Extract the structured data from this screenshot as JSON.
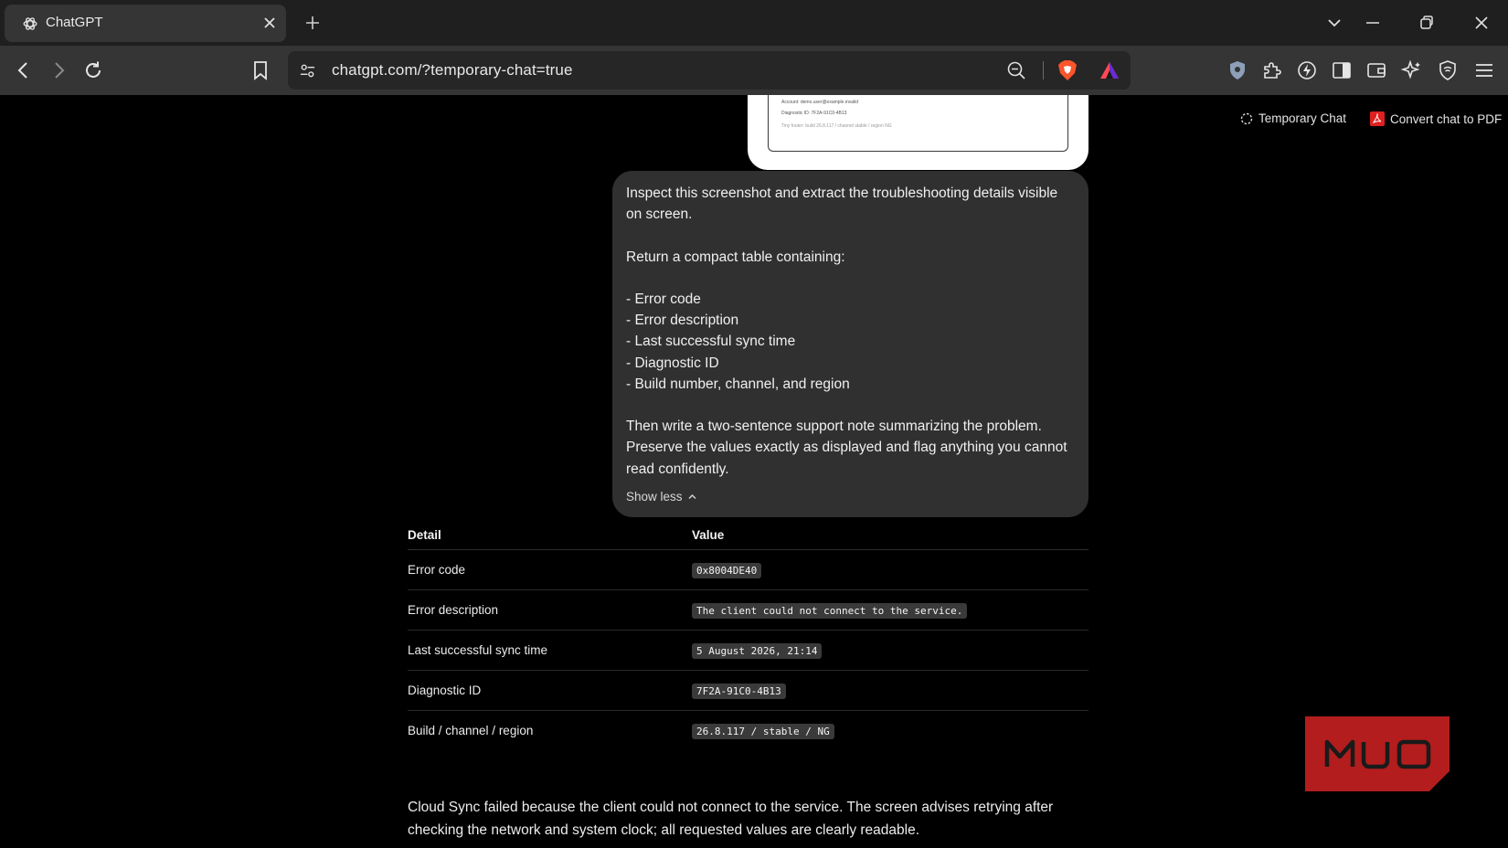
{
  "browser": {
    "tab_title": "ChatGPT",
    "url": "chatgpt.com/?temporary-chat=true"
  },
  "header": {
    "temporary_chat": "Temporary Chat",
    "convert_pdf": "Convert chat to PDF"
  },
  "attached_image": {
    "lines": [
      "Account: demo.user@example.invalid",
      "Diagnostic ID: 7F2A-91C0-4B13",
      "Tiny footer: build 26.8.117 / channel stable / region NG"
    ]
  },
  "user_message": {
    "line1": "Inspect this screenshot and extract the troubleshooting details visible",
    "line2": "on screen.",
    "line3": "Return a compact table containing:",
    "items": [
      "- Error code",
      "- Error description",
      "- Last successful sync time",
      "- Diagnostic ID",
      "- Build number, channel, and region"
    ],
    "line4": "Then write a two-sentence support note summarizing the problem.",
    "line5": "Preserve the values exactly as displayed and flag anything you cannot",
    "line6": "read confidently.",
    "show_less": "Show less"
  },
  "response_table": {
    "headers": [
      "Detail",
      "Value"
    ],
    "rows": [
      {
        "detail": "Error code",
        "value": "0x8004DE40"
      },
      {
        "detail": "Error description",
        "value": "The client could not connect to the service."
      },
      {
        "detail": "Last successful sync time",
        "value": "5 August 2026, 21:14"
      },
      {
        "detail": "Diagnostic ID",
        "value": "7F2A-91C0-4B13"
      },
      {
        "detail": "Build / channel / region",
        "value": "26.8.117 / stable / NG"
      }
    ]
  },
  "response_summary": {
    "line1": "Cloud Sync failed because the client could not connect to the service. The screen advises retrying after",
    "line2": "checking the network and system clock; all requested values are clearly readable."
  },
  "watermark": "MUO",
  "colors": {
    "page_bg": "#000000",
    "bubble_bg": "#303030",
    "toolbar_bg": "#353535",
    "brave_orange": "#fb542b",
    "watermark_red": "#b31d1d"
  }
}
